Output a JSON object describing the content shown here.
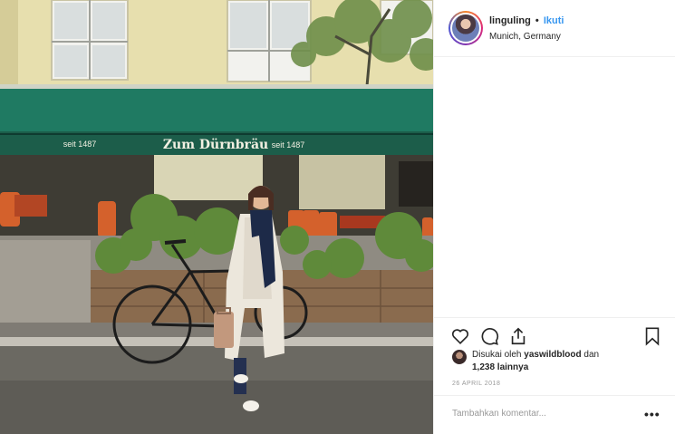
{
  "post": {
    "username": "linguling",
    "separator": "•",
    "follow_label": "Ikuti",
    "location": "Munich, Germany",
    "photo": {
      "awning_text": "Zum Dürnbräu",
      "awning_seit_left": "seit 1487",
      "awning_seit_right": "seit 1487"
    },
    "likes": {
      "prefix": "Disukai oleh",
      "user": "yaswildblood",
      "connector": "dan",
      "count": "1,238 lainnya"
    },
    "date": "26 APRIL 2018",
    "comment_placeholder": "Tambahkan komentar...",
    "more_label": "•••"
  },
  "icons": {
    "like": "heart-icon",
    "comment": "comment-bubble-icon",
    "share": "share-icon",
    "save": "bookmark-icon",
    "more": "more-options-icon"
  },
  "colors": {
    "follow": "#3897f0",
    "awning": "#1f7a62",
    "border": "#efefef"
  }
}
